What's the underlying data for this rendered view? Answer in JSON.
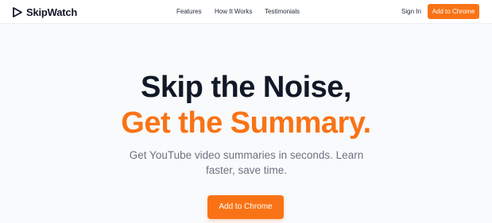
{
  "brand": {
    "name": "SkipWatch",
    "icon": "play-outline-icon"
  },
  "nav": {
    "items": [
      {
        "label": "Features"
      },
      {
        "label": "How It Works"
      },
      {
        "label": "Testimonials"
      }
    ]
  },
  "header": {
    "sign_in_label": "Sign In",
    "cta_label": "Add to Chrome"
  },
  "hero": {
    "title_line1": "Skip the Noise,",
    "title_line2": "Get the Summary.",
    "subtitle": "Get YouTube video summaries in seconds. Learn faster, save time.",
    "cta_label": "Add to Chrome"
  },
  "colors": {
    "accent": "#f97316",
    "heading": "#111827",
    "muted": "#6b7280",
    "background": "#f9fafb"
  }
}
